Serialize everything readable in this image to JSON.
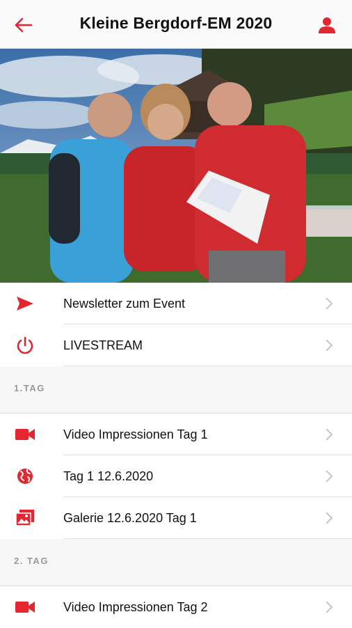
{
  "header": {
    "title": "Kleine Bergdorf-EM 2020",
    "back_icon": "arrow-left-icon",
    "user_icon": "user-icon"
  },
  "hero": {
    "alt": "Event photo"
  },
  "top_items": [
    {
      "label": "Newsletter zum Event",
      "icon": "send-icon"
    },
    {
      "label": "LIVESTREAM",
      "icon": "power-icon"
    }
  ],
  "sections": [
    {
      "title": "1.TAG",
      "items": [
        {
          "label": "Video Impressionen Tag 1",
          "icon": "video-icon"
        },
        {
          "label": "Tag 1 12.6.2020",
          "icon": "globe-icon"
        },
        {
          "label": "Galerie 12.6.2020 Tag 1",
          "icon": "gallery-icon"
        }
      ]
    },
    {
      "title": "2. TAG",
      "items": [
        {
          "label": "Video Impressionen Tag 2",
          "icon": "video-icon"
        }
      ]
    }
  ],
  "colors": {
    "accent": "#e3262f",
    "chevron": "#c7c7c7",
    "section_text": "#9a9a9a"
  }
}
